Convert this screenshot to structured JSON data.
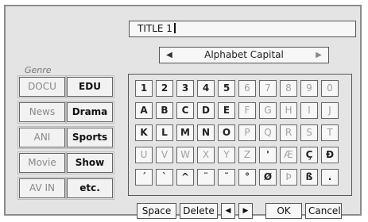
{
  "title_field": {
    "value": "TITLE 1"
  },
  "mode_selector": {
    "label": "Alphabet Capital",
    "left_arrow": "◀",
    "right_arrow": "▶"
  },
  "genre": {
    "label": "Genre",
    "buttons": [
      {
        "label": "DOCU",
        "active": false
      },
      {
        "label": "EDU",
        "active": true
      },
      {
        "label": "News",
        "active": false
      },
      {
        "label": "Drama",
        "active": true
      },
      {
        "label": "ANI",
        "active": false
      },
      {
        "label": "Sports",
        "active": true
      },
      {
        "label": "Movie",
        "active": false
      },
      {
        "label": "Show",
        "active": true
      },
      {
        "label": "AV IN",
        "active": false
      },
      {
        "label": "etc.",
        "active": true
      }
    ]
  },
  "keyboard": {
    "keys": [
      {
        "label": "1",
        "dim": false
      },
      {
        "label": "2",
        "dim": false
      },
      {
        "label": "3",
        "dim": false
      },
      {
        "label": "4",
        "dim": false
      },
      {
        "label": "5",
        "dim": false
      },
      {
        "label": "6",
        "dim": true
      },
      {
        "label": "7",
        "dim": true
      },
      {
        "label": "8",
        "dim": true
      },
      {
        "label": "9",
        "dim": true
      },
      {
        "label": "0",
        "dim": true
      },
      {
        "label": "A",
        "dim": false
      },
      {
        "label": "B",
        "dim": false
      },
      {
        "label": "C",
        "dim": false
      },
      {
        "label": "D",
        "dim": false
      },
      {
        "label": "E",
        "dim": false
      },
      {
        "label": "F",
        "dim": true
      },
      {
        "label": "G",
        "dim": true
      },
      {
        "label": "H",
        "dim": true
      },
      {
        "label": "I",
        "dim": true
      },
      {
        "label": "J",
        "dim": true
      },
      {
        "label": "K",
        "dim": false
      },
      {
        "label": "L",
        "dim": false
      },
      {
        "label": "M",
        "dim": false
      },
      {
        "label": "N",
        "dim": false
      },
      {
        "label": "O",
        "dim": false
      },
      {
        "label": "P",
        "dim": true
      },
      {
        "label": "Q",
        "dim": true
      },
      {
        "label": "R",
        "dim": true
      },
      {
        "label": "S",
        "dim": true
      },
      {
        "label": "T",
        "dim": true
      },
      {
        "label": "U",
        "dim": true
      },
      {
        "label": "V",
        "dim": true
      },
      {
        "label": "W",
        "dim": true
      },
      {
        "label": "X",
        "dim": true
      },
      {
        "label": "Y",
        "dim": true
      },
      {
        "label": "Z",
        "dim": true
      },
      {
        "label": "'",
        "dim": false
      },
      {
        "label": "Æ",
        "dim": true
      },
      {
        "label": "Ç",
        "dim": false
      },
      {
        "label": "Ð",
        "dim": false
      },
      {
        "label": "´",
        "dim": false
      },
      {
        "label": "`",
        "dim": false
      },
      {
        "label": "^",
        "dim": false
      },
      {
        "label": "¨",
        "dim": false
      },
      {
        "label": "˜",
        "dim": false
      },
      {
        "label": "°",
        "dim": false
      },
      {
        "label": "Ø",
        "dim": false
      },
      {
        "label": "Þ",
        "dim": true
      },
      {
        "label": "ß",
        "dim": false
      },
      {
        "label": ".",
        "dim": false
      }
    ]
  },
  "bottom_bar": {
    "space": "Space",
    "delete": "Delete",
    "left": "◀",
    "right": "▶",
    "ok": "OK",
    "cancel": "Cancel"
  }
}
